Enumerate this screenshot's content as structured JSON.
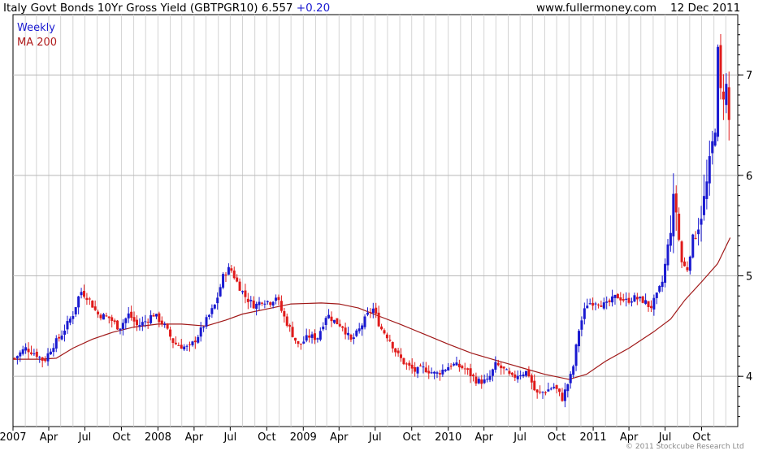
{
  "header": {
    "title": "Italy Govt Bonds 10Yr Gross Yield (GBTPGR10)",
    "last_value": "6.557",
    "change": "+0.20",
    "site": "www.fullermoney.com",
    "date": "12 Dec 2011"
  },
  "copyright": "© 2011 Stockcube Research Ltd",
  "colors": {
    "up": "#1a1ad0",
    "down": "#e01b1b",
    "ma": "#a01818",
    "grid": "#d4d4d4",
    "axis": "#000000"
  },
  "chart_data": {
    "type": "candlestick",
    "interval": "weekly",
    "legend": [
      "Weekly",
      "MA 200"
    ],
    "legend_position": "top-left",
    "grid": true,
    "ylim": [
      3.5,
      7.6
    ],
    "y_ticks": [
      4,
      5,
      6,
      7
    ],
    "x_tick_labels": [
      "2007",
      "Apr",
      "Jul",
      "Oct",
      "2008",
      "Apr",
      "Jul",
      "Oct",
      "2009",
      "Apr",
      "Jul",
      "Oct",
      "2010",
      "Apr",
      "Jul",
      "Oct",
      "2011",
      "Apr",
      "Jul",
      "Oct"
    ],
    "x_range": [
      "2007-01-01",
      "2011-12-31"
    ],
    "series": [
      {
        "name": "Weekly",
        "kind": "close",
        "points": [
          [
            "2007-01-05",
            4.18
          ],
          [
            "2007-02-01",
            4.28
          ],
          [
            "2007-03-01",
            4.22
          ],
          [
            "2007-03-20",
            4.15
          ],
          [
            "2007-04-10",
            4.3
          ],
          [
            "2007-05-01",
            4.4
          ],
          [
            "2007-06-01",
            4.62
          ],
          [
            "2007-06-20",
            4.85
          ],
          [
            "2007-07-10",
            4.78
          ],
          [
            "2007-08-01",
            4.62
          ],
          [
            "2007-09-01",
            4.58
          ],
          [
            "2007-09-25",
            4.48
          ],
          [
            "2007-10-20",
            4.62
          ],
          [
            "2007-11-10",
            4.5
          ],
          [
            "2007-12-01",
            4.55
          ],
          [
            "2007-12-20",
            4.62
          ],
          [
            "2008-01-15",
            4.52
          ],
          [
            "2008-02-10",
            4.33
          ],
          [
            "2008-03-01",
            4.3
          ],
          [
            "2008-03-20",
            4.28
          ],
          [
            "2008-04-10",
            4.4
          ],
          [
            "2008-05-01",
            4.55
          ],
          [
            "2008-05-25",
            4.72
          ],
          [
            "2008-06-15",
            5.02
          ],
          [
            "2008-07-01",
            5.08
          ],
          [
            "2008-07-20",
            4.92
          ],
          [
            "2008-08-10",
            4.78
          ],
          [
            "2008-09-01",
            4.7
          ],
          [
            "2008-09-20",
            4.76
          ],
          [
            "2008-10-10",
            4.74
          ],
          [
            "2008-10-25",
            4.8
          ],
          [
            "2008-11-10",
            4.62
          ],
          [
            "2008-12-01",
            4.45
          ],
          [
            "2008-12-20",
            4.3
          ],
          [
            "2009-01-15",
            4.4
          ],
          [
            "2009-02-05",
            4.38
          ],
          [
            "2009-03-01",
            4.62
          ],
          [
            "2009-03-20",
            4.55
          ],
          [
            "2009-04-10",
            4.5
          ],
          [
            "2009-05-01",
            4.35
          ],
          [
            "2009-05-20",
            4.45
          ],
          [
            "2009-06-10",
            4.6
          ],
          [
            "2009-06-25",
            4.68
          ],
          [
            "2009-07-15",
            4.48
          ],
          [
            "2009-08-05",
            4.38
          ],
          [
            "2009-08-25",
            4.22
          ],
          [
            "2009-09-15",
            4.12
          ],
          [
            "2009-10-10",
            4.05
          ],
          [
            "2009-11-01",
            4.08
          ],
          [
            "2009-12-01",
            4.02
          ],
          [
            "2010-01-10",
            4.12
          ],
          [
            "2010-02-10",
            4.08
          ],
          [
            "2010-03-15",
            3.95
          ],
          [
            "2010-04-10",
            3.95
          ],
          [
            "2010-05-01",
            4.12
          ],
          [
            "2010-05-25",
            4.05
          ],
          [
            "2010-06-10",
            3.98
          ],
          [
            "2010-06-25",
            4.02
          ],
          [
            "2010-07-20",
            4.05
          ],
          [
            "2010-08-10",
            3.82
          ],
          [
            "2010-09-01",
            3.85
          ],
          [
            "2010-09-25",
            3.9
          ],
          [
            "2010-10-15",
            3.78
          ],
          [
            "2010-11-10",
            4.05
          ],
          [
            "2010-11-25",
            4.45
          ],
          [
            "2010-12-15",
            4.72
          ],
          [
            "2011-01-10",
            4.75
          ],
          [
            "2011-02-01",
            4.7
          ],
          [
            "2011-03-01",
            4.8
          ],
          [
            "2011-03-25",
            4.75
          ],
          [
            "2011-04-15",
            4.78
          ],
          [
            "2011-05-10",
            4.75
          ],
          [
            "2011-05-25",
            4.68
          ],
          [
            "2011-06-10",
            4.8
          ],
          [
            "2011-06-25",
            4.95
          ],
          [
            "2011-07-10",
            5.35
          ],
          [
            "2011-07-25",
            5.82
          ],
          [
            "2011-08-10",
            5.15
          ],
          [
            "2011-08-25",
            5.05
          ],
          [
            "2011-09-10",
            5.4
          ],
          [
            "2011-09-25",
            5.55
          ],
          [
            "2011-10-10",
            5.8
          ],
          [
            "2011-10-25",
            6.2
          ],
          [
            "2011-11-05",
            6.55
          ],
          [
            "2011-11-10",
            7.25
          ],
          [
            "2011-11-20",
            6.7
          ],
          [
            "2011-12-01",
            7.0
          ],
          [
            "2011-12-05",
            6.5
          ],
          [
            "2011-12-12",
            6.56
          ]
        ]
      },
      {
        "name": "MA 200",
        "kind": "line",
        "points": [
          [
            "2007-01-01",
            4.17
          ],
          [
            "2007-03-10",
            4.17
          ],
          [
            "2007-04-20",
            4.18
          ],
          [
            "2007-06-01",
            4.28
          ],
          [
            "2007-07-20",
            4.37
          ],
          [
            "2007-09-10",
            4.44
          ],
          [
            "2007-11-01",
            4.49
          ],
          [
            "2008-01-01",
            4.52
          ],
          [
            "2008-03-01",
            4.52
          ],
          [
            "2008-05-01",
            4.5
          ],
          [
            "2008-06-20",
            4.56
          ],
          [
            "2008-08-01",
            4.62
          ],
          [
            "2008-10-01",
            4.67
          ],
          [
            "2008-12-01",
            4.72
          ],
          [
            "2009-02-15",
            4.73
          ],
          [
            "2009-04-01",
            4.72
          ],
          [
            "2009-05-20",
            4.68
          ],
          [
            "2009-07-10",
            4.6
          ],
          [
            "2009-09-01",
            4.52
          ],
          [
            "2009-11-01",
            4.42
          ],
          [
            "2010-01-01",
            4.32
          ],
          [
            "2010-03-01",
            4.23
          ],
          [
            "2010-05-01",
            4.16
          ],
          [
            "2010-07-01",
            4.09
          ],
          [
            "2010-09-01",
            4.02
          ],
          [
            "2010-11-01",
            3.97
          ],
          [
            "2010-12-15",
            4.02
          ],
          [
            "2011-02-01",
            4.15
          ],
          [
            "2011-04-01",
            4.28
          ],
          [
            "2011-06-01",
            4.44
          ],
          [
            "2011-07-15",
            4.57
          ],
          [
            "2011-08-20",
            4.76
          ],
          [
            "2011-10-01",
            4.94
          ],
          [
            "2011-11-10",
            5.12
          ],
          [
            "2011-12-12",
            5.38
          ]
        ]
      }
    ]
  }
}
